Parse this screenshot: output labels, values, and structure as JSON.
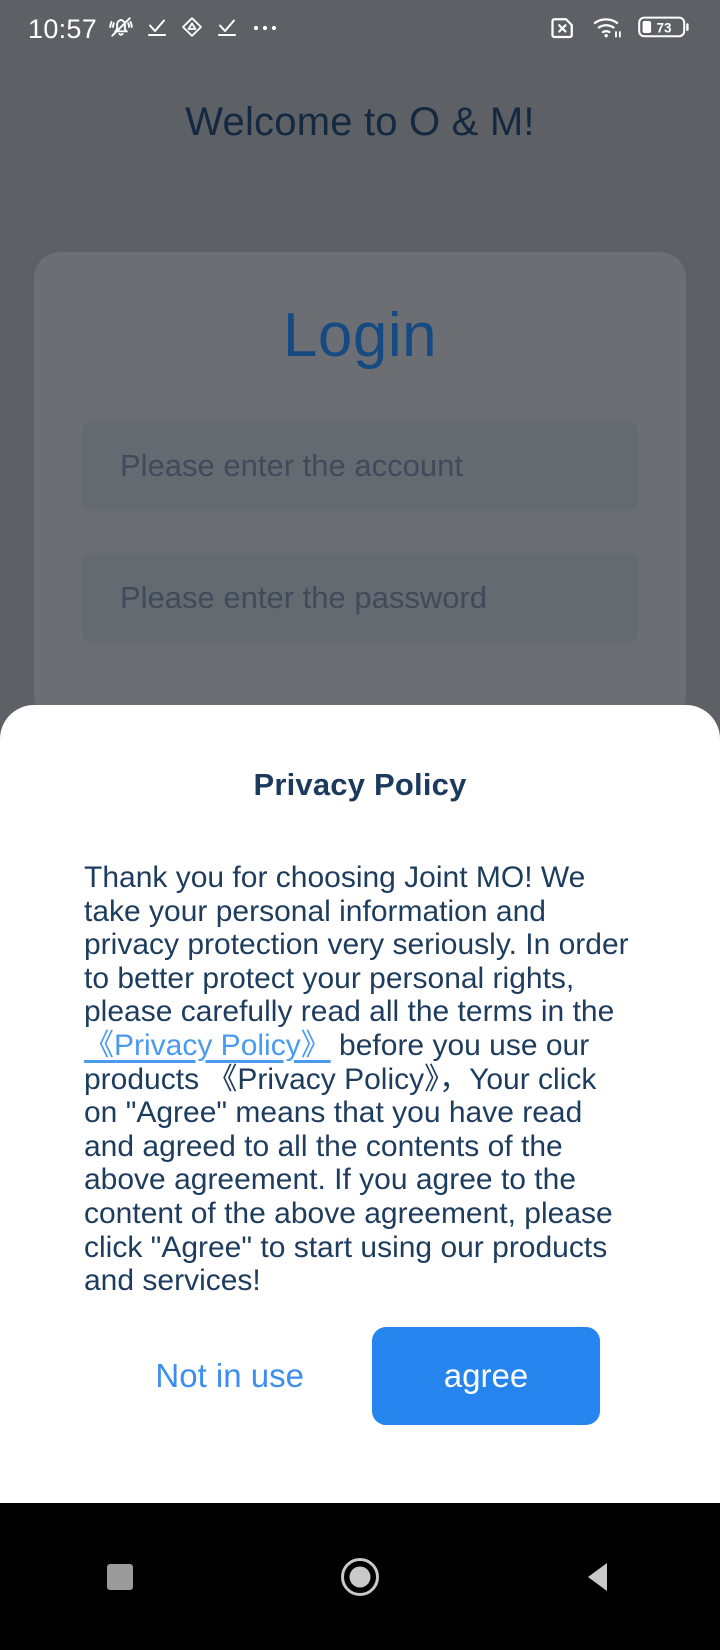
{
  "status_bar": {
    "time": "10:57",
    "left_icons": [
      "bell-muted-icon",
      "check-underline-icon",
      "triangle-badge-icon",
      "check-underline-icon",
      "ellipsis-icon"
    ],
    "right_icons": [
      "sim-card-x-icon",
      "wifi-icon",
      "battery-icon"
    ],
    "battery_level": "73"
  },
  "login_page": {
    "welcome": "Welcome to O & M!",
    "title": "Login",
    "account_placeholder": "Please enter the account",
    "password_placeholder": "Please enter the password"
  },
  "privacy_dialog": {
    "title": "Privacy Policy",
    "body_part1": "Thank you for choosing Joint MO! We take your personal information and privacy protection very seriously. In order to better protect your personal rights, please carefully read all the terms in the ",
    "link_text": "《Privacy Policy》",
    "body_part2": " before you use our products 《Privacy Policy》，Your click on \"Agree\" means that you have read and agreed to all the contents of the above agreement. If you agree to the content of the above agreement, please click \"Agree\" to start using our products and services!",
    "decline_label": "Not in use",
    "agree_label": "agree"
  },
  "nav_bar": {
    "recents_label": "recents-square-icon",
    "home_label": "home-circle-icon",
    "back_label": "back-triangle-icon"
  },
  "colors": {
    "accent_blue": "#2684ee",
    "link_blue": "#4a9bf0",
    "navy": "#1e3c5e",
    "login_blue": "#164a82",
    "dim_background": "#5d6166"
  }
}
